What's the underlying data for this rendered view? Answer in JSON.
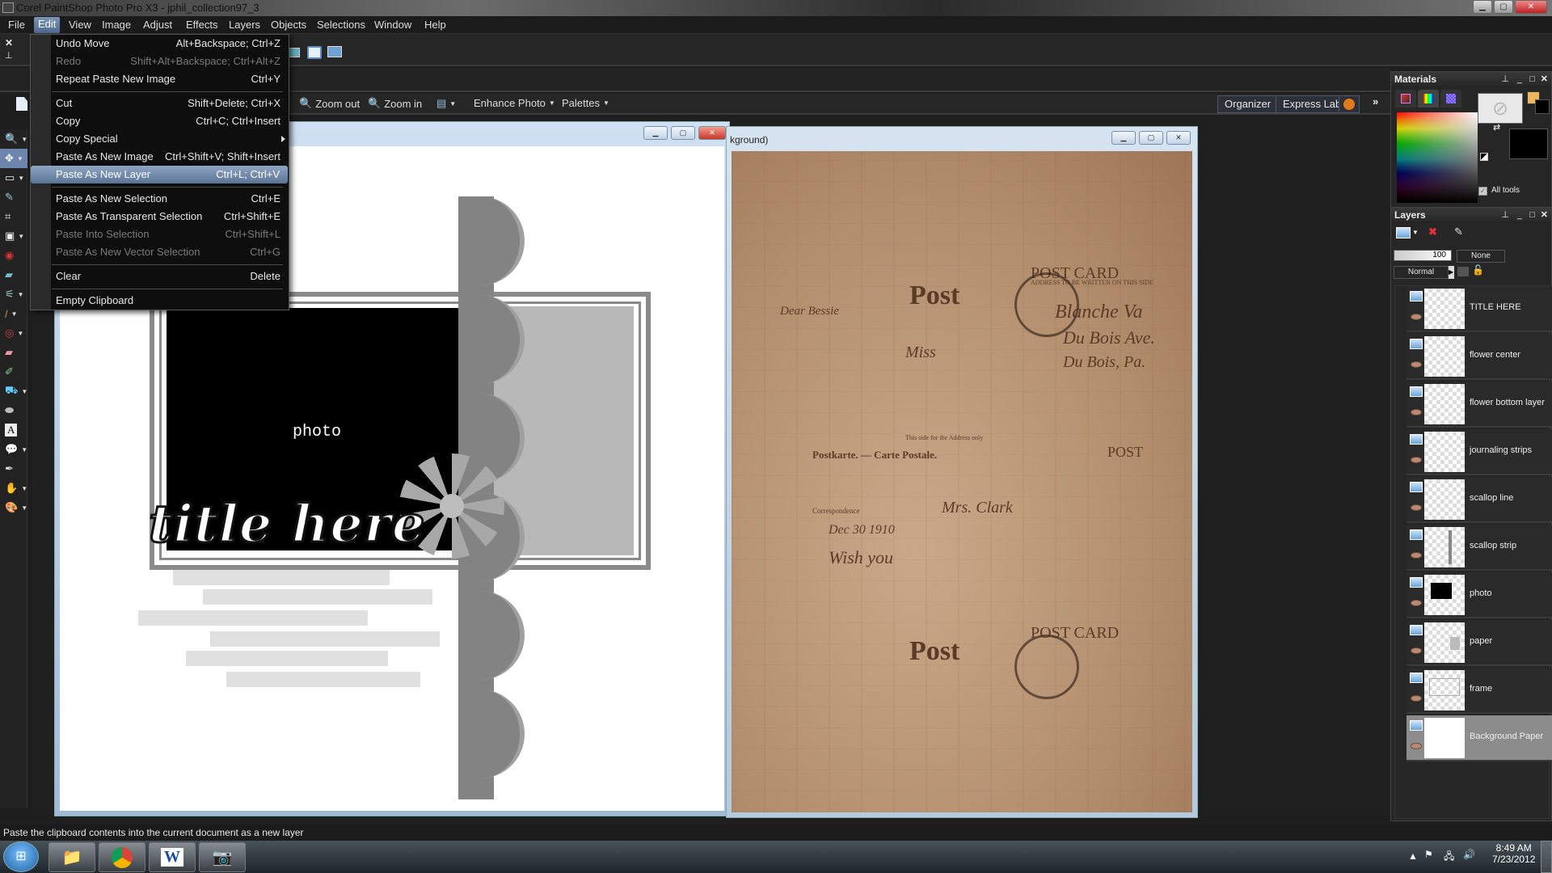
{
  "window": {
    "title": "Corel PaintShop Photo Pro X3 - jphil_collection97_3"
  },
  "menubar": [
    "File",
    "Edit",
    "View",
    "Image",
    "Adjust",
    "Effects",
    "Layers",
    "Objects",
    "Selections",
    "Window",
    "Help"
  ],
  "active_menu": "Edit",
  "edit_menu": {
    "items": [
      {
        "label": "Undo Move",
        "shortcut": "Alt+Backspace; Ctrl+Z",
        "enabled": true
      },
      {
        "label": "Redo",
        "shortcut": "Shift+Alt+Backspace; Ctrl+Alt+Z",
        "enabled": false
      },
      {
        "label": "Repeat  Paste New Image",
        "shortcut": "Ctrl+Y",
        "enabled": true
      },
      {
        "label": "Cut",
        "shortcut": "Shift+Delete; Ctrl+X",
        "enabled": true
      },
      {
        "label": "Copy",
        "shortcut": "Ctrl+C; Ctrl+Insert",
        "enabled": true
      },
      {
        "label": "Copy Special",
        "shortcut": "",
        "enabled": true,
        "submenu": true
      },
      {
        "label": "Paste As New Image",
        "shortcut": "Ctrl+Shift+V; Shift+Insert",
        "enabled": true
      },
      {
        "label": "Paste As New Layer",
        "shortcut": "Ctrl+L; Ctrl+V",
        "enabled": true,
        "highlighted": true
      },
      {
        "label": "Paste As New Selection",
        "shortcut": "Ctrl+E",
        "enabled": true
      },
      {
        "label": "Paste As Transparent Selection",
        "shortcut": "Ctrl+Shift+E",
        "enabled": true
      },
      {
        "label": "Paste Into Selection",
        "shortcut": "Ctrl+Shift+L",
        "enabled": false
      },
      {
        "label": "Paste As New Vector Selection",
        "shortcut": "Ctrl+G",
        "enabled": false
      },
      {
        "label": "Clear",
        "shortcut": "Delete",
        "enabled": true
      },
      {
        "label": "Empty Clipboard",
        "shortcut": "",
        "enabled": true
      }
    ]
  },
  "toolbar": {
    "zoom_out": "Zoom out",
    "zoom_in": "Zoom in",
    "enhance_photo": "Enhance Photo",
    "palettes": "Palettes",
    "organizer": "Organizer",
    "express_lab": "Express Lab",
    "overflow": "»"
  },
  "tools": [
    "zoom",
    "move",
    "selection",
    "dropper",
    "crop",
    "straighten",
    "red-eye",
    "makeover",
    "clone",
    "paint-brush",
    "dodge",
    "eraser",
    "color-replacer",
    "flood-fill",
    "object-remover",
    "text",
    "preset-shape",
    "pen",
    "smudge",
    "art-media"
  ],
  "doc1": {
    "photo_label": "photo",
    "title_art": "title here"
  },
  "doc2": {
    "title_fragment": "kground)",
    "postcard_texts": [
      "Post",
      "POST CARD",
      "Postkarte. — Carte Postale.",
      "POST",
      "Dear Bessie",
      "ADDRESS TO BE WRITTEN ON THIS SIDE",
      "This side for the Address only",
      "Correspondence",
      "Blanche Va",
      "Du Bois Ave.",
      "Du Bois, Pa.",
      "Mrs. Clark",
      "Wish you",
      "Dec 30 1910",
      "Miss"
    ]
  },
  "materials": {
    "title": "Materials",
    "all_tools_label": "All tools",
    "all_tools_checked": true,
    "foreground_color": "#e8b85a",
    "background_color": "#000000"
  },
  "layers": {
    "title": "Layers",
    "opacity": "100",
    "blend": "Normal",
    "link": "None",
    "items": [
      {
        "name": "TITLE HERE",
        "selected": false
      },
      {
        "name": "flower center",
        "selected": false
      },
      {
        "name": "flower bottom layer",
        "selected": false
      },
      {
        "name": "journaling strips",
        "selected": false
      },
      {
        "name": "scallop line",
        "selected": false
      },
      {
        "name": "scallop strip",
        "selected": false
      },
      {
        "name": "photo",
        "selected": false
      },
      {
        "name": "paper",
        "selected": false
      },
      {
        "name": "frame",
        "selected": false
      },
      {
        "name": "Background Paper",
        "selected": true
      }
    ]
  },
  "status": {
    "text": "Paste the clipboard contents into the current document as a new layer"
  },
  "taskbar": {
    "time": "8:49 AM",
    "date": "7/23/2012",
    "apps": [
      "explorer",
      "chrome",
      "word",
      "paintshop"
    ]
  }
}
